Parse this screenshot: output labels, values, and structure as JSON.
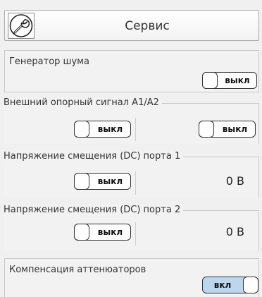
{
  "header": {
    "title": "Сервис",
    "icon": "wrench-icon"
  },
  "noise_generator": {
    "label": "Генератор шума",
    "state": "выкл"
  },
  "ext_reference": {
    "label": "Внешний опорный сигнал A1/A2",
    "left_state": "выкл",
    "right_state": "выкл"
  },
  "dc_bias_port1": {
    "label": "Напряжение смещения (DC) порта 1",
    "state": "выкл",
    "value": "0 В"
  },
  "dc_bias_port2": {
    "label": "Напряжение смещения (DC) порта 2",
    "state": "выкл",
    "value": "0 В"
  },
  "attenuator_comp": {
    "label": "Компенсация аттенюаторов",
    "state": "вкл"
  },
  "colors": {
    "toggle_on_bg": "#bcd6ee",
    "panel_bg": "#f2f2f2",
    "border": "#c8c8c8"
  }
}
